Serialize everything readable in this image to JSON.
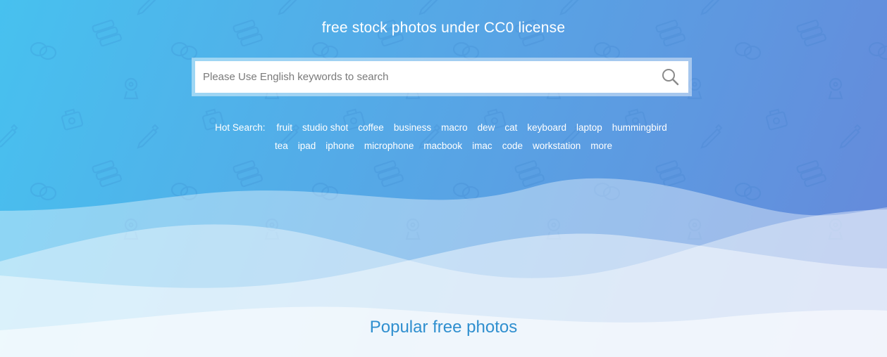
{
  "header": {
    "tagline": "free stock photos under CC0 license"
  },
  "search": {
    "placeholder": "Please Use English keywords to search",
    "button_icon": "search-icon"
  },
  "hot_search": {
    "label": "Hot Search:",
    "row1": [
      "fruit",
      "studio shot",
      "coffee",
      "business",
      "macro",
      "dew",
      "cat",
      "keyboard",
      "laptop",
      "hummingbird"
    ],
    "row2": [
      "tea",
      "ipad",
      "iphone",
      "microphone",
      "macbook",
      "imac",
      "code",
      "workstation",
      "more"
    ]
  },
  "section": {
    "title": "Popular free photos"
  },
  "colors": {
    "gradient_start": "#47c1ef",
    "gradient_end": "#6688da",
    "section_title": "#2f8fcf"
  },
  "background_icons": [
    "chat-bubbles-icon",
    "stacked-cards-icon",
    "stamp-icon",
    "camera-bag-icon",
    "pencil-icon"
  ]
}
